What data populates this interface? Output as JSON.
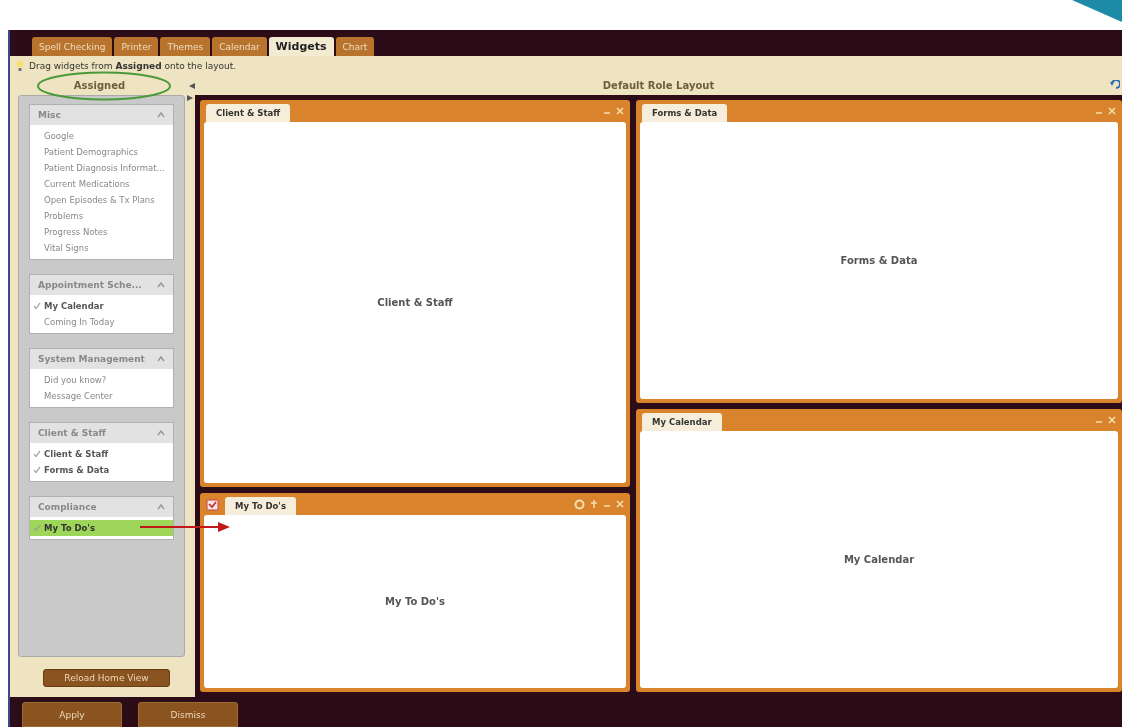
{
  "tabs": [
    {
      "label": "Spell Checking",
      "selected": false
    },
    {
      "label": "Printer",
      "selected": false
    },
    {
      "label": "Themes",
      "selected": false
    },
    {
      "label": "Calendar",
      "selected": false
    },
    {
      "label": "Widgets",
      "selected": true
    },
    {
      "label": "Chart",
      "selected": false
    }
  ],
  "hint": "Drag widgets from **Assigned** onto the layout.",
  "sidebar": {
    "title": "Assigned",
    "groups": [
      {
        "title": "Misc",
        "items": [
          {
            "label": "Google",
            "checked": false,
            "selected": false
          },
          {
            "label": "Patient Demographics",
            "checked": false,
            "selected": false
          },
          {
            "label": "Patient Diagnosis Informat...",
            "checked": false,
            "selected": false
          },
          {
            "label": "Current Medications",
            "checked": false,
            "selected": false
          },
          {
            "label": "Open Episodes & Tx Plans",
            "checked": false,
            "selected": false
          },
          {
            "label": "Problems",
            "checked": false,
            "selected": false
          },
          {
            "label": "Progress Notes",
            "checked": false,
            "selected": false
          },
          {
            "label": "Vital Signs",
            "checked": false,
            "selected": false
          }
        ]
      },
      {
        "title": "Appointment Sche...",
        "items": [
          {
            "label": "My Calendar",
            "checked": true,
            "selected": false
          },
          {
            "label": "Coming In Today",
            "checked": false,
            "selected": false
          }
        ]
      },
      {
        "title": "System Management",
        "items": [
          {
            "label": "Did you know?",
            "checked": false,
            "selected": false
          },
          {
            "label": "Message Center",
            "checked": false,
            "selected": false
          }
        ]
      },
      {
        "title": "Client & Staff",
        "items": [
          {
            "label": "Client & Staff",
            "checked": true,
            "selected": false
          },
          {
            "label": "Forms & Data",
            "checked": true,
            "selected": false
          }
        ]
      },
      {
        "title": "Compliance",
        "items": [
          {
            "label": "My To Do's",
            "checked": true,
            "selected": true
          }
        ]
      }
    ],
    "reload_button": "Reload Home View"
  },
  "layout": {
    "title": "Default Role Layout",
    "columns": [
      {
        "widgets": [
          {
            "title": "Client & Staff",
            "kind": "standard",
            "body": "Client & Staff"
          },
          {
            "title": "My To Do's",
            "kind": "todo",
            "body": "My To Do's"
          }
        ]
      },
      {
        "widgets": [
          {
            "title": "Forms & Data",
            "kind": "standard",
            "body": "Forms & Data"
          },
          {
            "title": "My Calendar",
            "kind": "standard",
            "body": "My Calendar"
          }
        ]
      }
    ]
  },
  "buttons": [
    "Apply",
    "Dismiss"
  ]
}
